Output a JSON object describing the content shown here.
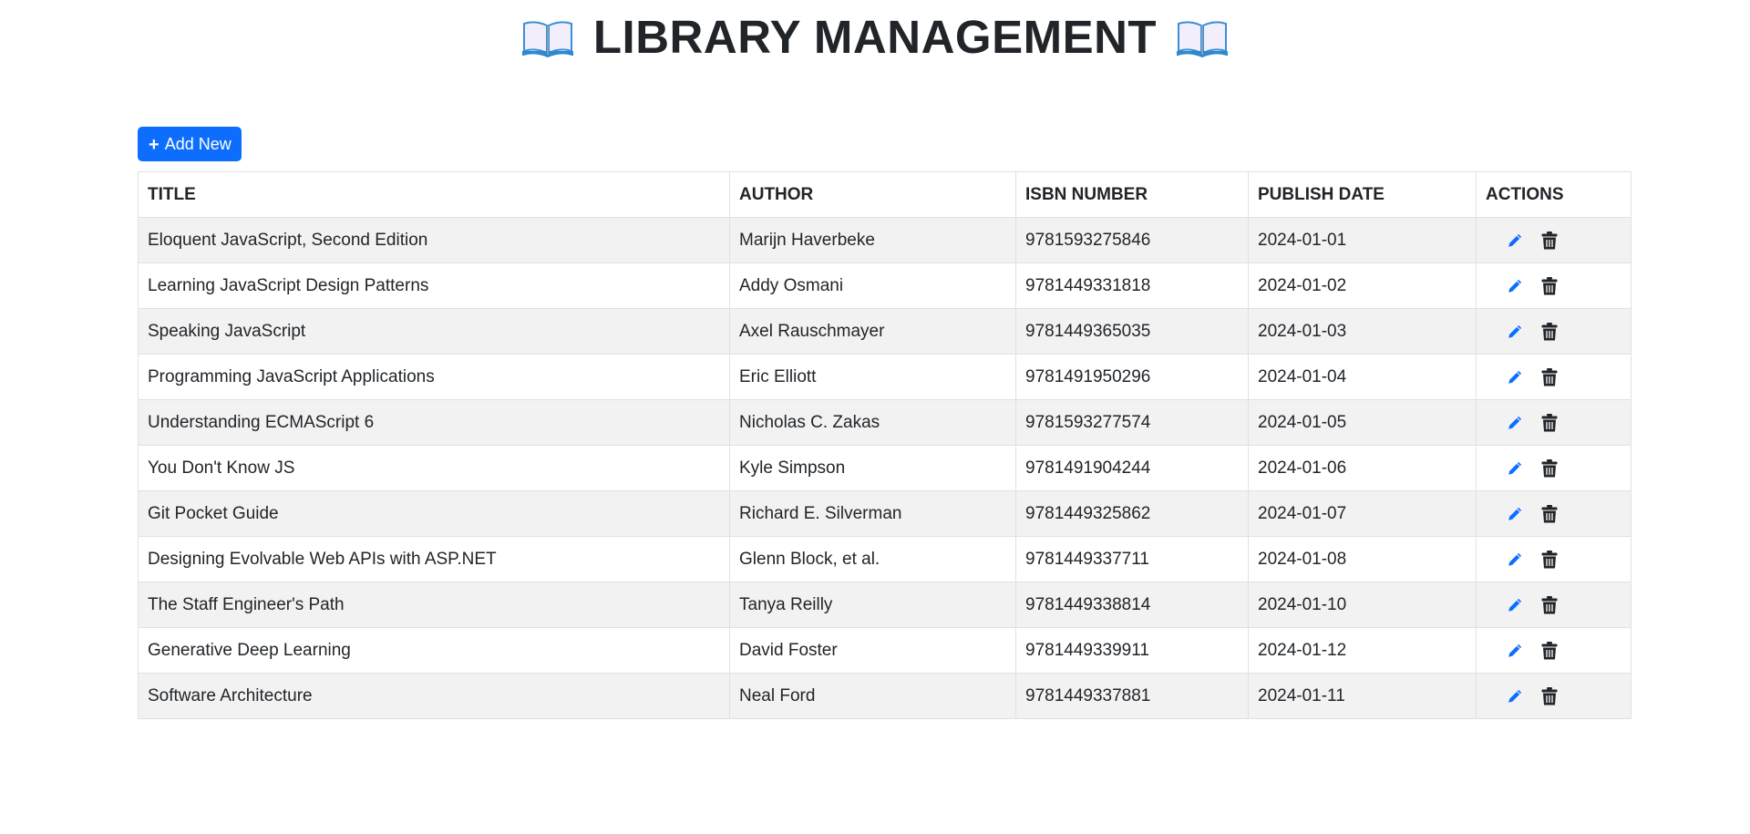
{
  "header": {
    "title": "LIBRARY MANAGEMENT"
  },
  "toolbar": {
    "add_label": "Add New",
    "add_icon": "+"
  },
  "table": {
    "columns": [
      "TITLE",
      "AUTHOR",
      "ISBN NUMBER",
      "PUBLISH DATE",
      "ACTIONS"
    ],
    "rows": [
      {
        "title": "Eloquent JavaScript, Second Edition",
        "author": "Marijn Haverbeke",
        "isbn": "9781593275846",
        "date": "2024-01-01"
      },
      {
        "title": "Learning JavaScript Design Patterns",
        "author": "Addy Osmani",
        "isbn": "9781449331818",
        "date": "2024-01-02"
      },
      {
        "title": "Speaking JavaScript",
        "author": "Axel Rauschmayer",
        "isbn": "9781449365035",
        "date": "2024-01-03"
      },
      {
        "title": "Programming JavaScript Applications",
        "author": "Eric Elliott",
        "isbn": "9781491950296",
        "date": "2024-01-04"
      },
      {
        "title": "Understanding ECMAScript 6",
        "author": "Nicholas C. Zakas",
        "isbn": "9781593277574",
        "date": "2024-01-05"
      },
      {
        "title": "You Don't Know JS",
        "author": "Kyle Simpson",
        "isbn": "9781491904244",
        "date": "2024-01-06"
      },
      {
        "title": "Git Pocket Guide",
        "author": "Richard E. Silverman",
        "isbn": "9781449325862",
        "date": "2024-01-07"
      },
      {
        "title": "Designing Evolvable Web APIs with ASP.NET",
        "author": "Glenn Block, et al.",
        "isbn": "9781449337711",
        "date": "2024-01-08"
      },
      {
        "title": "The Staff Engineer's Path",
        "author": "Tanya Reilly",
        "isbn": "9781449338814",
        "date": "2024-01-10"
      },
      {
        "title": "Generative Deep Learning",
        "author": "David Foster",
        "isbn": "9781449339911",
        "date": "2024-01-12"
      },
      {
        "title": "Software Architecture",
        "author": "Neal Ford",
        "isbn": "9781449337881",
        "date": "2024-01-11"
      }
    ]
  },
  "colors": {
    "primary": "#0d6efd",
    "edit_icon": "#0d6efd",
    "delete_icon": "#212529",
    "striped_row": "#f2f2f2",
    "border": "#dee2e6"
  },
  "icons": {
    "title_left": "open-book-icon",
    "title_right": "open-book-icon",
    "edit": "pencil-icon",
    "delete": "trash-icon"
  }
}
